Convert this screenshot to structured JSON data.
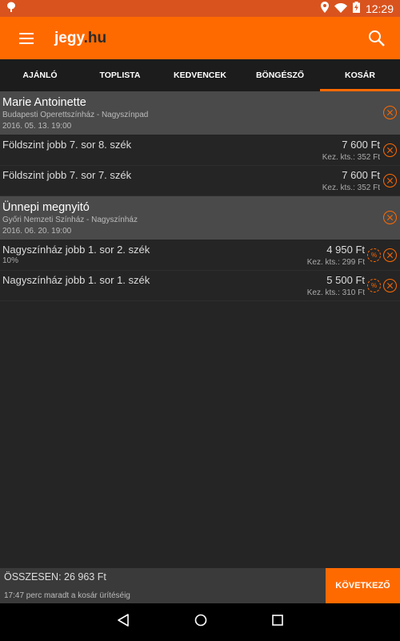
{
  "status_bar": {
    "time": "12:29"
  },
  "app": {
    "logo_main": "jegy",
    "logo_tld": ".hu"
  },
  "tabs": [
    "AJÁNLÓ",
    "TOPLISTA",
    "KEDVENCEK",
    "BÖNGÉSZŐ",
    "KOSÁR"
  ],
  "active_tab": "KOSÁR",
  "cart": [
    {
      "title": "Marie Antoinette",
      "venue": "Budapesti Operettszínház - Nagyszínpad",
      "date": "2016. 05. 13. 19:00",
      "tickets": [
        {
          "seat": "Földszint jobb 7. sor 8. szék",
          "note": "",
          "price": "7 600 Ft",
          "fee": "Kez. kts.: 352 Ft",
          "discount": false
        },
        {
          "seat": "Földszint jobb 7. sor 7. szék",
          "note": "",
          "price": "7 600 Ft",
          "fee": "Kez. kts.: 352 Ft",
          "discount": false
        }
      ]
    },
    {
      "title": "Ünnepi megnyitó",
      "venue": "Győri Nemzeti Színház - Nagyszínház",
      "date": "2016. 06. 20. 19:00",
      "tickets": [
        {
          "seat": "Nagyszínház jobb 1. sor 2. szék",
          "note": "10%",
          "price": "4 950 Ft",
          "fee": "Kez. kts.: 299 Ft",
          "discount": true
        },
        {
          "seat": "Nagyszínház jobb 1. sor 1. szék",
          "note": "",
          "price": "5 500 Ft",
          "fee": "Kez. kts.: 310 Ft",
          "discount": true
        }
      ]
    }
  ],
  "footer": {
    "total": "ÖSSZESEN: 26 963 Ft",
    "timer": "17:47 perc maradt a kosár ürítéséig",
    "next_label": "KÖVETKEZŐ"
  },
  "discount_symbol": "%",
  "colors": {
    "accent": "#ff6a00",
    "background": "#252525",
    "event_header": "#4a4a4a"
  }
}
